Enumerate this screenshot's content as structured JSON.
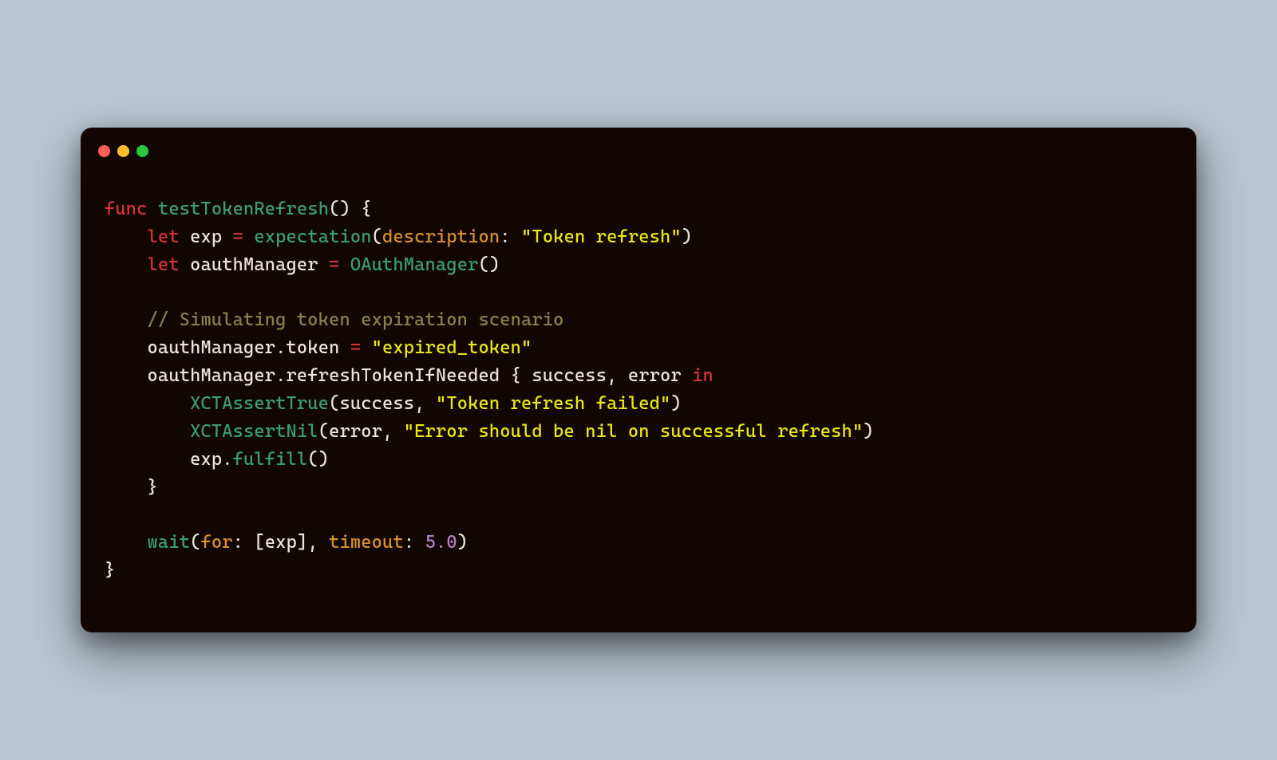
{
  "code": {
    "l1": {
      "func": "func",
      "name": "testTokenRefresh",
      "paren_open": "(",
      "paren_close": ")",
      "brace_open": " {"
    },
    "l2": {
      "indent": "    ",
      "let": "let",
      "var": " exp ",
      "eq": "=",
      "sp": " ",
      "call": "expectation",
      "open": "(",
      "param": "description",
      "colon": ": ",
      "str": "\"Token refresh\"",
      "close": ")"
    },
    "l3": {
      "indent": "    ",
      "let": "let",
      "var": " oauthManager ",
      "eq": "=",
      "sp": " ",
      "call": "OAuthManager",
      "open": "(",
      "close": ")"
    },
    "l4": "",
    "l5": {
      "indent": "    ",
      "comment": "// Simulating token expiration scenario"
    },
    "l6": {
      "indent": "    ",
      "obj": "oauthManager",
      "dot": ".",
      "prop": "token ",
      "eq": "=",
      "sp": " ",
      "str": "\"expired_token\""
    },
    "l7": {
      "indent": "    ",
      "obj": "oauthManager",
      "dot": ".",
      "method": "refreshTokenIfNeeded ",
      "brace_open": "{",
      "sp": " ",
      "p1": "success",
      "comma": ", ",
      "p2": "error ",
      "in": "in"
    },
    "l8": {
      "indent": "        ",
      "call": "XCTAssertTrue",
      "open": "(",
      "arg": "success",
      "comma": ", ",
      "str": "\"Token refresh failed\"",
      "close": ")"
    },
    "l9": {
      "indent": "        ",
      "call": "XCTAssertNil",
      "open": "(",
      "arg": "error",
      "comma": ", ",
      "str": "\"Error should be nil on successful refresh\"",
      "close": ")"
    },
    "l10": {
      "indent": "        ",
      "obj": "exp",
      "dot": ".",
      "method": "fulfill",
      "open": "(",
      "close": ")"
    },
    "l11": {
      "indent": "    ",
      "brace_close": "}"
    },
    "l12": "",
    "l13": {
      "indent": "    ",
      "call": "wait",
      "open": "(",
      "param": "for",
      "colon": ": ",
      "lbrack": "[",
      "arg": "exp",
      "rbrack": "]",
      "comma": ", ",
      "param2": "timeout",
      "colon2": ": ",
      "num": "5.0",
      "close": ")"
    },
    "l14": {
      "brace_close": "}"
    }
  }
}
